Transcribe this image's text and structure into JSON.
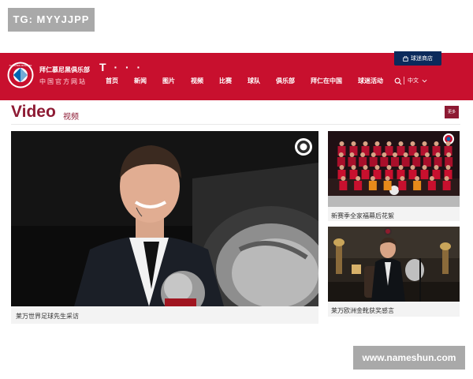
{
  "watermarks": {
    "top": "TG: MYYJJPP",
    "bottom": "www.nameshun.com"
  },
  "header": {
    "brand_cn": "拜仁慕尼黑俱乐部",
    "brand_sub": "中国官方网站",
    "sponsor_mark": "T · · ·",
    "store_label": "球迷商店",
    "language": "中文",
    "logo_text": "FC BAYERN MÜNCHEN",
    "nav": [
      "首页",
      "新闻",
      "图片",
      "视频",
      "比赛",
      "球队",
      "俱乐部",
      "拜仁在中国",
      "球迷活动"
    ]
  },
  "section": {
    "title_en": "Video",
    "title_cn": "视频",
    "more_label": "更多"
  },
  "videos": [
    {
      "caption": "莱万世界足球先生采访"
    },
    {
      "caption": "新赛季全家福幕后花絮"
    },
    {
      "caption": "莱万欧洲金靴获奖感言"
    }
  ],
  "colors": {
    "header": "#c8102e",
    "accent": "#8d1a33",
    "store": "#0b2a5b"
  }
}
